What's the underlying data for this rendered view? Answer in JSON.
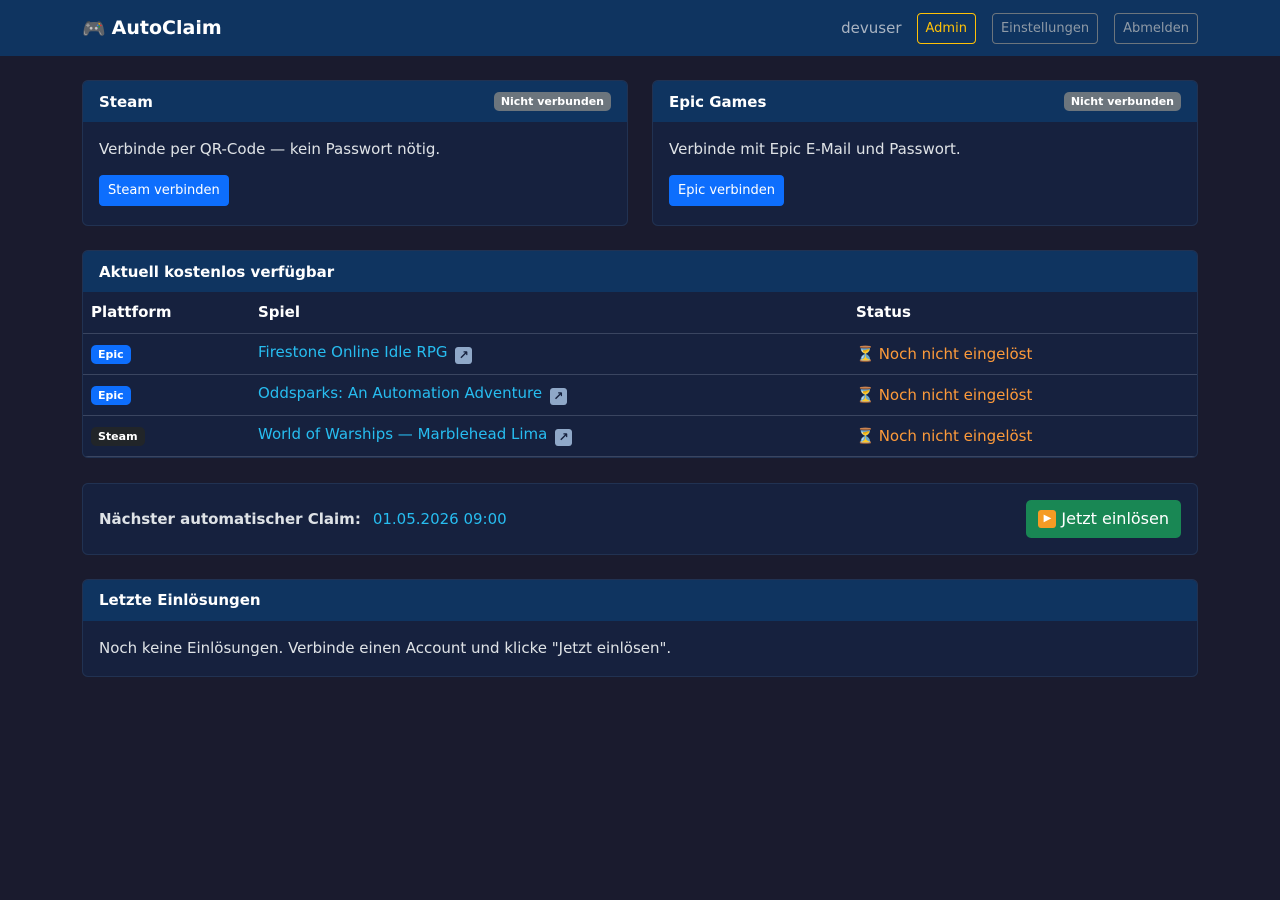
{
  "navbar": {
    "brand_icon": "🎮",
    "brand": "AutoClaim",
    "username": "devuser",
    "admin_label": "Admin",
    "settings_label": "Einstellungen",
    "logout_label": "Abmelden"
  },
  "steam": {
    "title": "Steam",
    "status": "Nicht verbunden",
    "text": "Verbinde per QR-Code — kein Passwort nötig.",
    "button": "Steam verbinden"
  },
  "epic": {
    "title": "Epic Games",
    "status": "Nicht verbunden",
    "text": "Verbinde mit Epic E-Mail und Passwort.",
    "button": "Epic verbinden"
  },
  "games": {
    "title": "Aktuell kostenlos verfügbar",
    "headers": {
      "platform": "Plattform",
      "game": "Spiel",
      "status": "Status"
    },
    "rows": [
      {
        "platform": "Epic",
        "game": "Firestone Online Idle RPG",
        "status": "Noch nicht eingelöst"
      },
      {
        "platform": "Epic",
        "game": "Oddsparks: An Automation Adventure",
        "status": "Noch nicht eingelöst"
      },
      {
        "platform": "Steam",
        "game": "World of Warships — Marblehead Lima",
        "status": "Noch nicht eingelöst"
      }
    ]
  },
  "claim": {
    "label": "Nächster automatischer Claim:",
    "time": "01.05.2026 09:00",
    "button": "Jetzt einlösen"
  },
  "history": {
    "title": "Letzte Einlösungen",
    "empty_text": "Noch keine Einlösungen. Verbinde einen Account und klicke \"Jetzt einlösen\"."
  },
  "icons": {
    "external_link": "external-link-icon",
    "hourglass": "hourglass-icon",
    "play": "play-icon"
  }
}
